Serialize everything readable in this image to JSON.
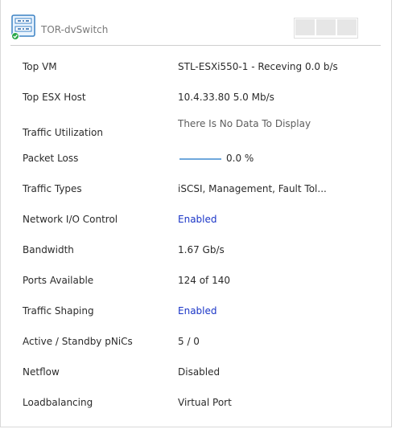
{
  "header": {
    "title": "TOR-dvSwitch"
  },
  "rows": [
    {
      "label": "Top VM",
      "value": "STL-ESXi550-1 - Receving 0.0 b/s"
    },
    {
      "label": "Top ESX Host",
      "value": "10.4.33.80 5.0 Mb/s"
    },
    {
      "label": "Traffic Utilization",
      "value": "There Is No Data To Display"
    },
    {
      "label": "Packet Loss",
      "value": "0.0 %"
    },
    {
      "label": "Traffic Types",
      "value": "iSCSI, Management, Fault Tol..."
    },
    {
      "label": "Network I/O Control",
      "value": "Enabled"
    },
    {
      "label": "Bandwidth",
      "value": "1.67 Gb/s"
    },
    {
      "label": "Ports Available",
      "value": "124 of 140"
    },
    {
      "label": "Traffic Shaping",
      "value": "Enabled"
    },
    {
      "label": "Active / Standby pNiCs",
      "value": "5 / 0"
    },
    {
      "label": "Netflow",
      "value": "Disabled"
    },
    {
      "label": "Loadbalancing",
      "value": "Virtual Port"
    }
  ],
  "colors": {
    "link": "#1a35c7",
    "packet_loss_line": "#6fa8dc",
    "status_ok": "#2aa84a"
  }
}
